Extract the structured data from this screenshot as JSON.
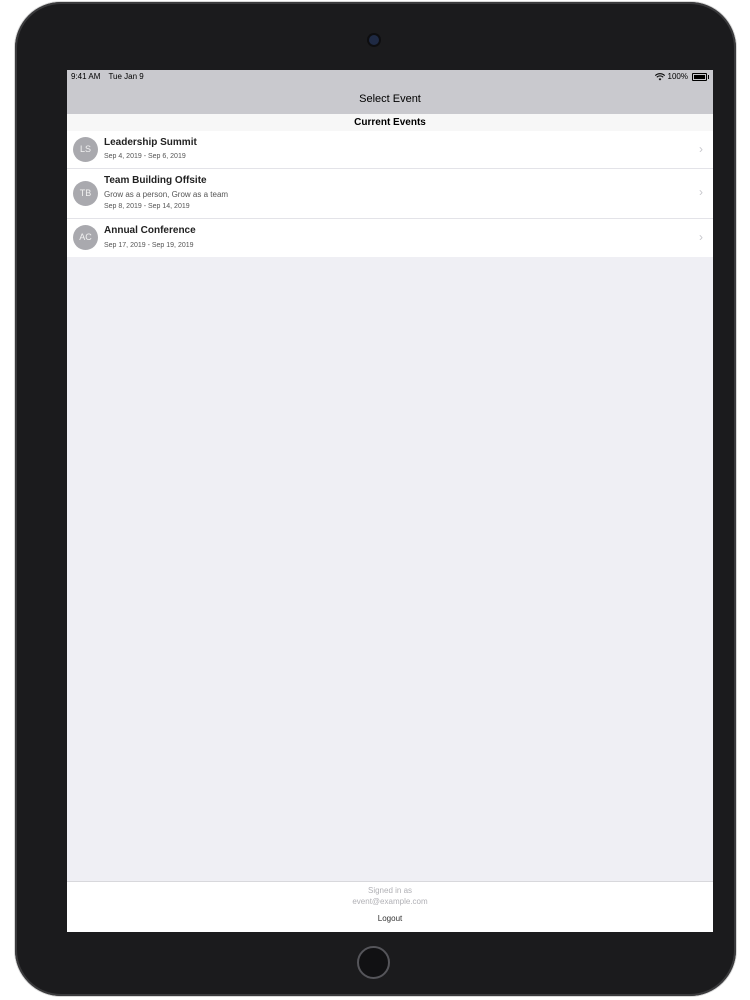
{
  "status_bar": {
    "time": "9:41 AM",
    "date": "Tue Jan 9",
    "battery": "100%",
    "wifi_icon": "wifi-icon",
    "battery_icon": "battery-icon"
  },
  "nav": {
    "title": "Select Event"
  },
  "section": {
    "title": "Current Events"
  },
  "events": [
    {
      "initials": "LS",
      "title": "Leadership Summit",
      "subtitle": "",
      "dates": "Sep 4, 2019 - Sep 6, 2019"
    },
    {
      "initials": "TB",
      "title": "Team Building Offsite",
      "subtitle": "Grow as a person, Grow as a team",
      "dates": "Sep 8, 2019 - Sep 14, 2019"
    },
    {
      "initials": "AC",
      "title": "Annual Conference",
      "subtitle": "",
      "dates": "Sep 17, 2019 - Sep 19, 2019"
    }
  ],
  "footer": {
    "signed_in_label": "Signed in as",
    "email": "event@example.com",
    "logout_label": "Logout"
  },
  "colors": {
    "bar_background": "#c9c9ce",
    "screen_background": "#efeff4",
    "avatar_background": "#a9a9ae",
    "chevron": "#c7c7cc",
    "device_bezel": "#1b1b1d"
  }
}
